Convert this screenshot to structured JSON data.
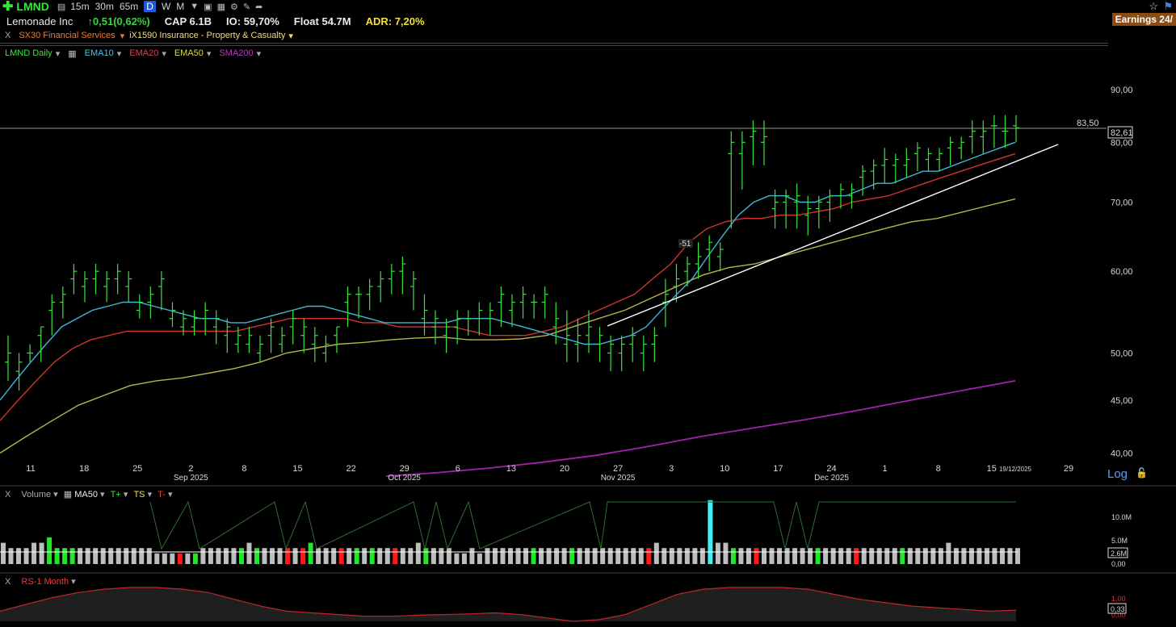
{
  "toolbar": {
    "symbol": "LMND",
    "timeframes": [
      "15m",
      "30m",
      "65m",
      "D",
      "W",
      "M"
    ],
    "active_timeframe": "D"
  },
  "info": {
    "company": "Lemonade Inc",
    "change": "↑0,51(0,62%)",
    "cap": "CAP 6.1B",
    "io": "IO: 59,70%",
    "float": "Float 54.7M",
    "adr": "ADR: 7,20%",
    "earnings": "Earnings 24/"
  },
  "sectors": {
    "close": "X",
    "sector1": "SX30 Financial Services",
    "sector2": "iX1590 Insurance - Property & Casualty"
  },
  "indicators": {
    "price": "LMND Daily",
    "ema10": "EMA10",
    "ema20": "EMA20",
    "ema50": "EMA50",
    "sma200": "SMA200"
  },
  "volume_pane": {
    "close": "X",
    "label": "Volume",
    "ma": "MA50",
    "tplus": "T+",
    "ts": "TS",
    "tminus": "T-",
    "axis": [
      "10.0M",
      "5.0M",
      "0,00"
    ],
    "current": "2.6M"
  },
  "rs_pane": {
    "close": "X",
    "label": "RS-1 Month",
    "axis": [
      "1,00",
      "0,00"
    ],
    "current": "0,33"
  },
  "log_label": "Log",
  "colors": {
    "bar": "#39e53c",
    "ema10": "#3fb7d6",
    "ema20": "#d0342c",
    "ema50": "#b8b34a",
    "sma200": "#a61fb0",
    "trendline": "#ffffff",
    "volume_up": "#24e52c",
    "volume_down": "#ff1a1a",
    "volume_neutral": "#bdbdbd",
    "volume_spike": "#3ef0f2",
    "rs": "#c0262a"
  },
  "chart_data": {
    "type": "ohlc",
    "scale": "log",
    "ylim": [
      38,
      96
    ],
    "price_axis_labels": [
      "90,00",
      "80,00",
      "70,00",
      "60,00",
      "50,00",
      "45,00",
      "40,00"
    ],
    "resistance_level": "83,50",
    "last_price": "82,61",
    "annotation": "-51",
    "x_ticks": [
      {
        "label": "11",
        "sub": ""
      },
      {
        "label": "18",
        "sub": ""
      },
      {
        "label": "25",
        "sub": ""
      },
      {
        "label": "2",
        "sub": "Sep 2025"
      },
      {
        "label": "8",
        "sub": ""
      },
      {
        "label": "15",
        "sub": ""
      },
      {
        "label": "22",
        "sub": ""
      },
      {
        "label": "29",
        "sub": "Oct 2025"
      },
      {
        "label": "6",
        "sub": ""
      },
      {
        "label": "13",
        "sub": ""
      },
      {
        "label": "20",
        "sub": ""
      },
      {
        "label": "27",
        "sub": "Nov 2025"
      },
      {
        "label": "3",
        "sub": ""
      },
      {
        "label": "10",
        "sub": ""
      },
      {
        "label": "17",
        "sub": ""
      },
      {
        "label": "24",
        "sub": "Dec 2025"
      },
      {
        "label": "1",
        "sub": ""
      },
      {
        "label": "8",
        "sub": ""
      },
      {
        "label": "15",
        "sub": ""
      },
      {
        "label": "19/12/2025",
        "sub": ""
      },
      {
        "label": "29",
        "sub": ""
      }
    ],
    "bars_high": [
      52,
      50,
      51,
      53,
      57,
      58,
      61,
      60,
      61,
      60,
      61,
      60,
      57,
      58,
      60,
      56,
      55,
      55,
      56,
      55,
      54,
      53,
      53,
      52,
      54,
      53,
      55,
      54,
      53,
      52,
      53,
      58,
      58,
      59,
      60,
      61,
      62,
      60,
      57,
      55,
      54,
      55,
      55,
      56,
      56,
      58,
      57,
      58,
      57,
      58,
      56,
      55,
      54,
      55,
      53,
      52,
      52,
      53,
      52,
      53,
      59,
      61,
      62,
      64,
      65,
      64,
      82,
      82,
      84,
      84,
      72,
      72,
      73,
      71,
      71,
      72,
      73,
      73,
      76,
      77,
      79,
      78,
      79,
      80,
      79,
      79,
      81,
      81,
      84,
      84,
      85,
      85,
      85
    ],
    "bars_low": [
      47,
      46,
      49,
      49,
      52,
      54,
      57,
      56,
      57,
      56,
      57,
      56,
      54,
      54,
      55,
      53,
      52,
      52,
      52,
      51,
      50,
      50,
      50,
      49,
      50,
      50,
      51,
      50,
      49,
      49,
      50,
      53,
      54,
      55,
      56,
      57,
      57,
      55,
      52,
      51,
      50,
      51,
      52,
      52,
      52,
      53,
      53,
      54,
      54,
      54,
      51,
      49,
      49,
      50,
      49,
      48,
      48,
      49,
      48,
      49,
      53,
      56,
      58,
      59,
      60,
      60,
      66,
      72,
      76,
      76,
      66,
      66,
      66,
      65,
      66,
      67,
      69,
      69,
      71,
      72,
      73,
      73,
      74,
      75,
      75,
      75,
      76,
      77,
      78,
      78,
      79,
      79,
      80
    ],
    "bars_open": [
      49,
      48,
      50,
      52,
      55,
      56,
      59,
      58,
      59,
      58,
      59,
      58,
      55,
      56,
      58,
      54,
      53,
      53,
      54,
      53,
      52,
      51,
      51,
      50,
      52,
      51,
      53,
      52,
      51,
      50,
      52,
      56,
      57,
      57,
      58,
      59,
      60,
      58,
      54,
      53,
      52,
      53,
      54,
      54,
      54,
      56,
      55,
      56,
      56,
      56,
      53,
      51,
      51,
      52,
      51,
      50,
      50,
      51,
      50,
      51,
      56,
      58,
      60,
      61,
      63,
      62,
      78,
      78,
      81,
      80,
      69,
      70,
      70,
      68,
      69,
      70,
      71,
      71,
      74,
      75,
      76,
      76,
      76,
      78,
      77,
      77,
      79,
      79,
      81,
      81,
      83,
      82,
      83
    ],
    "bars_close": [
      50,
      49,
      50,
      53,
      56,
      57,
      60,
      59,
      60,
      59,
      60,
      59,
      56,
      57,
      59,
      55,
      54,
      54,
      55,
      54,
      53,
      52,
      52,
      51,
      53,
      52,
      54,
      53,
      52,
      51,
      53,
      57,
      57,
      58,
      59,
      60,
      61,
      59,
      55,
      54,
      53,
      54,
      54,
      55,
      55,
      57,
      56,
      57,
      56,
      57,
      54,
      52,
      52,
      53,
      52,
      51,
      51,
      52,
      51,
      52,
      57,
      59,
      61,
      62,
      64,
      63,
      80,
      80,
      82,
      81,
      70,
      71,
      71,
      69,
      70,
      71,
      72,
      72,
      75,
      76,
      77,
      77,
      77,
      79,
      78,
      78,
      80,
      80,
      82,
      82,
      83,
      82,
      82.6
    ],
    "ema10": [
      45,
      47,
      49,
      51,
      53,
      54,
      55,
      55.5,
      56,
      56,
      55.5,
      55,
      54.5,
      54,
      54,
      53.5,
      53.5,
      54,
      54.5,
      55,
      55.5,
      55.5,
      55,
      54.5,
      54,
      53.5,
      53.5,
      53.5,
      53.5,
      53.5,
      54,
      54,
      54,
      53.5,
      53,
      52.5,
      52,
      51.5,
      51,
      51,
      51.5,
      52,
      53,
      55,
      57,
      59,
      62,
      65,
      68,
      70,
      71,
      71,
      70,
      70,
      71,
      71,
      72,
      73,
      73,
      74,
      75,
      75,
      76,
      77,
      78,
      79,
      80
    ],
    "ema20": [
      43,
      45,
      47,
      49,
      50.5,
      51.5,
      52,
      52.5,
      52.5,
      52.5,
      52.5,
      52.5,
      52.5,
      52.5,
      53,
      53.5,
      54,
      54,
      54,
      54,
      53.5,
      53.5,
      53,
      53,
      53,
      53,
      52.5,
      52,
      52,
      52,
      52.5,
      53,
      54,
      55,
      56,
      57,
      59,
      61,
      64,
      66,
      67,
      67.5,
      67.5,
      68,
      68,
      68.5,
      69,
      70,
      70.5,
      71,
      72,
      73,
      74,
      75,
      76,
      77,
      78
    ],
    "ema50": [
      40,
      41.5,
      43,
      44.5,
      45.5,
      46.5,
      47,
      47.3,
      47.8,
      48.3,
      49,
      50,
      50.5,
      51,
      51.2,
      51.5,
      51.7,
      51.8,
      51.5,
      51.5,
      51.6,
      52,
      53,
      54,
      55,
      56.5,
      58,
      59.5,
      60.5,
      61,
      62,
      63,
      64,
      65,
      66,
      67,
      67.5,
      68.5,
      69.5,
      70.5
    ],
    "sma200": [
      38,
      38.3,
      38.7,
      39.2,
      39.8,
      40.6,
      41.5,
      42.3,
      43.1,
      44,
      45,
      46,
      47
    ],
    "volume": [
      4,
      3,
      3,
      3,
      4,
      4,
      5,
      3,
      3,
      3,
      3,
      3,
      3,
      3,
      3,
      3,
      3,
      3,
      3,
      3,
      2,
      2,
      2,
      2,
      2,
      2,
      3,
      3,
      3,
      3,
      3,
      3,
      4,
      3,
      3,
      3,
      3,
      3,
      3,
      3,
      4,
      3,
      3,
      3,
      3,
      3,
      3,
      3,
      3,
      3,
      3,
      3,
      3,
      3,
      4,
      3,
      3,
      3,
      3,
      2,
      2,
      3,
      2,
      3,
      3,
      3,
      3,
      3,
      3,
      3,
      3,
      3,
      3,
      3,
      3,
      3,
      3,
      3,
      3,
      3,
      3,
      3,
      3,
      3,
      3,
      4,
      3,
      3,
      3,
      3,
      3,
      3,
      12,
      4,
      4,
      3,
      3,
      3,
      3,
      3,
      3,
      3,
      3,
      3,
      3,
      3,
      3,
      3,
      3,
      3,
      3,
      3,
      3,
      3,
      3,
      3,
      3,
      3,
      3,
      3,
      3,
      3,
      3,
      4,
      3,
      3,
      3,
      3,
      3,
      3,
      3,
      3,
      3
    ],
    "rs": [
      0.3,
      0.5,
      0.7,
      0.85,
      0.95,
      1.0,
      1.0,
      0.95,
      0.85,
      0.65,
      0.45,
      0.3,
      0.25,
      0.2,
      0.15,
      0.15,
      0.18,
      0.2,
      0.22,
      0.25,
      0.2,
      0.1,
      0.0,
      0.05,
      0.2,
      0.5,
      0.8,
      0.95,
      1.0,
      1.0,
      1.0,
      0.95,
      0.8,
      0.65,
      0.55,
      0.45,
      0.4,
      0.35,
      0.3,
      0.33
    ]
  }
}
